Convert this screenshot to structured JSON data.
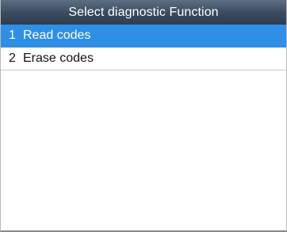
{
  "header": {
    "title": "Select diagnostic Function"
  },
  "menu": {
    "items": [
      {
        "number": "1",
        "label": "Read codes",
        "selected": true
      },
      {
        "number": "2",
        "label": "Erase codes",
        "selected": false
      }
    ]
  },
  "colors": {
    "title_bar": "#3b4a5e",
    "selection": "#2f8fe6",
    "divider": "#c8c8c8"
  }
}
